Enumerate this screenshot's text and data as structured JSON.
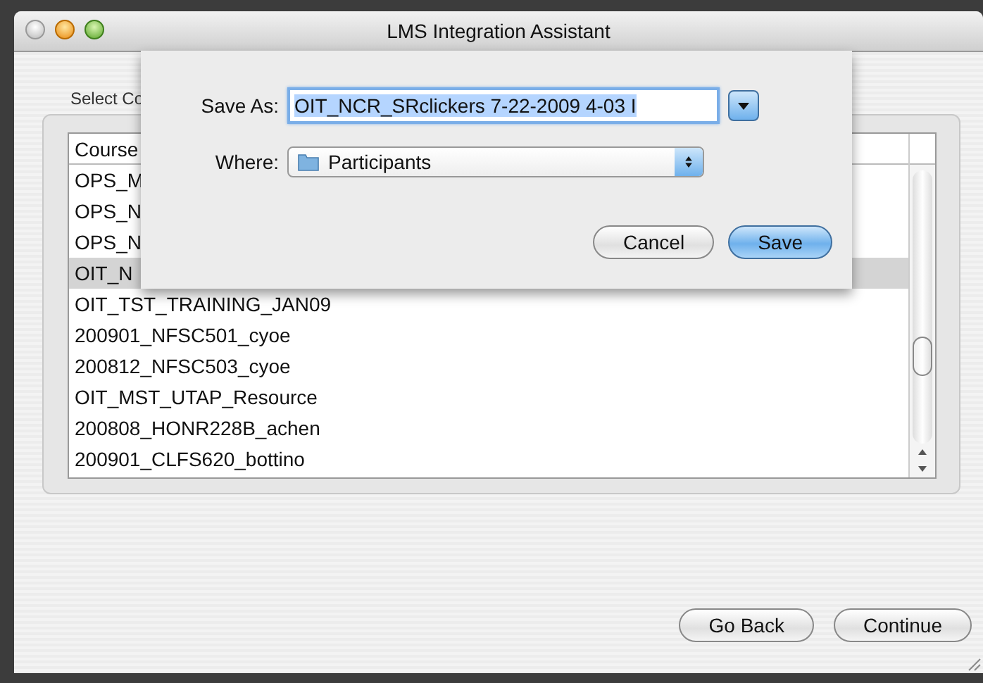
{
  "window": {
    "title": "LMS Integration Assistant"
  },
  "group_label": "Select Co",
  "table": {
    "columns": [
      "Course"
    ],
    "rows": [
      {
        "name": "OPS_M",
        "selected": false
      },
      {
        "name": "OPS_N",
        "selected": false
      },
      {
        "name": "OPS_N",
        "selected": false
      },
      {
        "name": "OIT_N",
        "selected": true
      },
      {
        "name": "OIT_TST_TRAINING_JAN09",
        "selected": false
      },
      {
        "name": "200901_NFSC501_cyoe",
        "selected": false
      },
      {
        "name": "200812_NFSC503_cyoe",
        "selected": false
      },
      {
        "name": "OIT_MST_UTAP_Resource",
        "selected": false
      },
      {
        "name": "200808_HONR228B_achen",
        "selected": false
      },
      {
        "name": "200901_CLFS620_bottino",
        "selected": false
      }
    ]
  },
  "buttons": [
    "Go Back",
    "Continue"
  ],
  "sheet": {
    "save_as_label": "Save As:",
    "save_as_value": "OIT_NCR_SRclickers 7-22-2009 4-03 I",
    "where_label": "Where:",
    "where_value": "Participants",
    "buttons": [
      {
        "label": "Cancel",
        "default": false
      },
      {
        "label": "Save",
        "default": true
      }
    ]
  }
}
